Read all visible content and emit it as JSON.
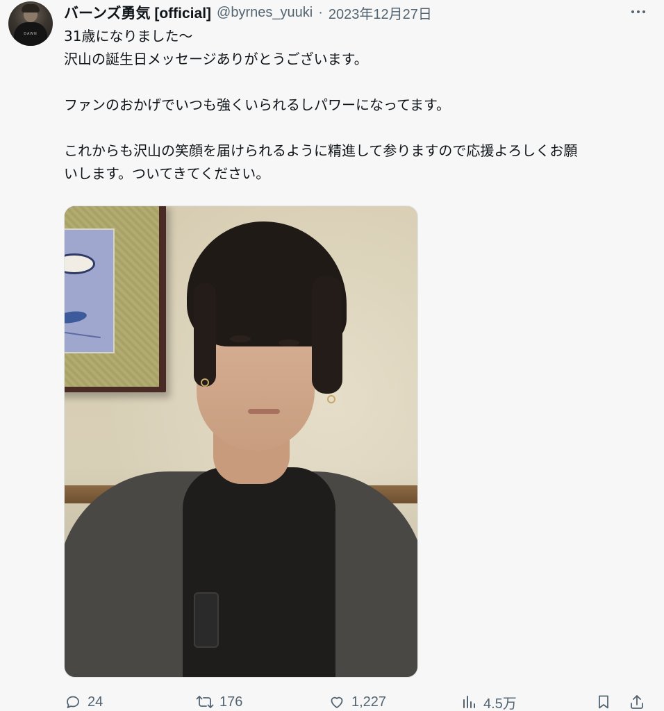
{
  "tweet": {
    "display_name": "バーンズ勇気 [official]",
    "handle": "@byrnes_yuuki",
    "separator": "·",
    "date": "2023年12月27日",
    "avatar_shirt_text": "DAWN",
    "text_lines": [
      "31歳になりました〜",
      "沢山の誕生日メッセージありがとうございます。",
      "",
      "ファンのおかげでいつも強くいられるしパワーになってます。",
      "",
      "これからも沢山の笑顔を届けられるように精進して参りますので応援よろしくお願",
      "いします。ついてきてください。"
    ]
  },
  "actions": {
    "replies": "24",
    "reposts": "176",
    "likes": "1,227",
    "views": "4.5万"
  },
  "colors": {
    "text": "#0f1419",
    "secondary": "#536471",
    "background": "#f7f7f7"
  },
  "icons": [
    "more-icon",
    "reply-icon",
    "repost-icon",
    "like-icon",
    "views-icon",
    "bookmark-icon",
    "share-icon"
  ]
}
